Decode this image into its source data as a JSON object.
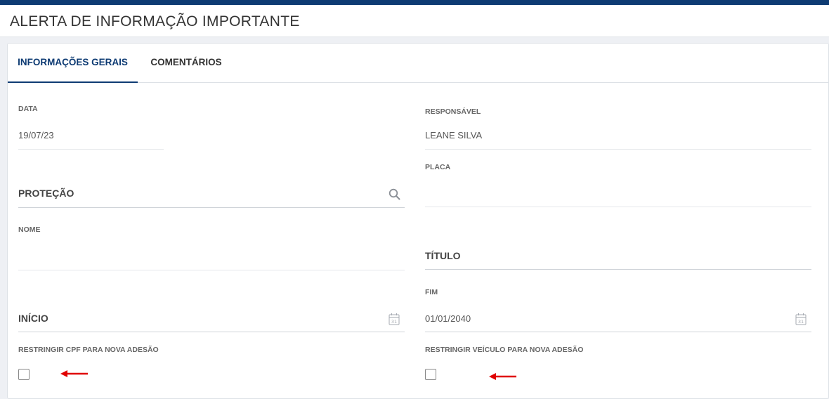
{
  "header": {
    "title": "ALERTA DE INFORMAÇÃO IMPORTANTE"
  },
  "tabs": [
    {
      "label": "INFORMAÇÕES GERAIS",
      "active": true
    },
    {
      "label": "COMENTÁRIOS",
      "active": false
    }
  ],
  "form": {
    "data": {
      "label": "DATA",
      "value": "19/07/23"
    },
    "responsavel": {
      "label": "RESPONSÁVEL",
      "value": "LEANE SILVA"
    },
    "placa": {
      "label": "PLACA",
      "value": ""
    },
    "protecao": {
      "label": "PROTEÇÃO",
      "icon": "search-icon"
    },
    "nome": {
      "label": "NOME",
      "value": ""
    },
    "titulo": {
      "label": "TÍTULO"
    },
    "inicio": {
      "label": "INÍCIO",
      "icon": "calendar-icon"
    },
    "fim": {
      "label": "FIM",
      "value": "01/01/2040",
      "icon": "calendar-icon"
    },
    "restringir_cpf": {
      "label": "RESTRINGIR CPF PARA NOVA ADESÃO",
      "checked": false
    },
    "restringir_veiculo": {
      "label": "RESTRINGIR VEÍCULO PARA NOVA ADESÃO",
      "checked": false
    }
  },
  "colors": {
    "brand": "#0e3b73",
    "annotation_arrow": "#e00000"
  }
}
